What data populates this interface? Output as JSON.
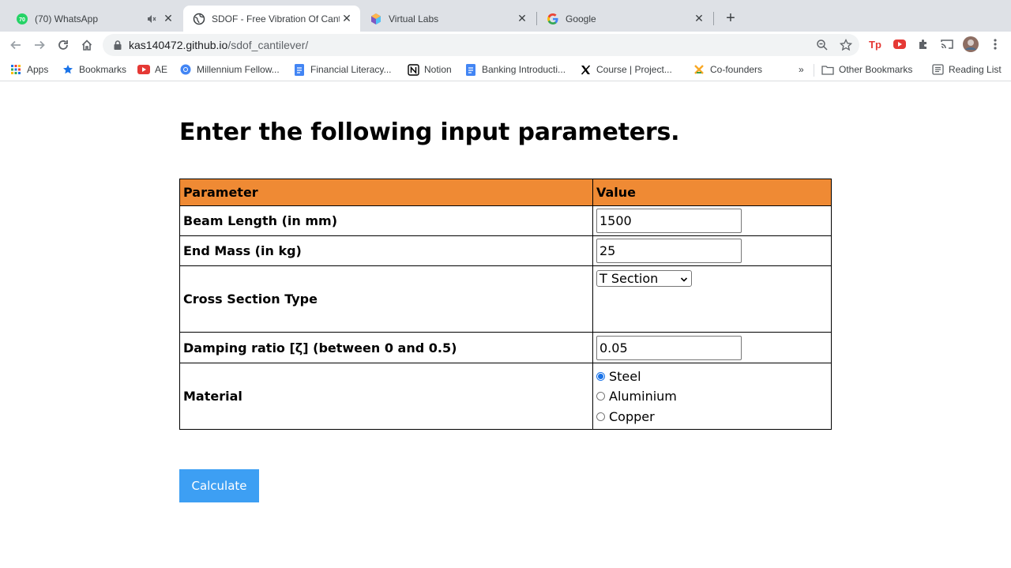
{
  "browser": {
    "tabs": [
      {
        "title": "(70) WhatsApp",
        "favicon": "whatsapp-icon",
        "badge": "70",
        "muted": true
      },
      {
        "title": "SDOF - Free Vibration Of Cantilever",
        "favicon": "globe-icon",
        "active": true
      },
      {
        "title": "Virtual Labs",
        "favicon": "virtual-labs-icon"
      },
      {
        "title": "Google",
        "favicon": "google-icon"
      }
    ],
    "url_host": "kas140472.github.io",
    "url_path": "/sdof_cantilever/",
    "bookmarks": [
      {
        "label": "Apps",
        "icon": "apps-grid-icon"
      },
      {
        "label": "Bookmarks",
        "icon": "star-icon"
      },
      {
        "label": "AE",
        "icon": "youtube-icon"
      },
      {
        "label": "Millennium Fellow...",
        "icon": "chrome-icon"
      },
      {
        "label": "Financial Literacy...",
        "icon": "google-docs-icon"
      },
      {
        "label": "Notion",
        "icon": "notion-icon"
      },
      {
        "label": "Banking Introducti...",
        "icon": "google-docs-icon"
      },
      {
        "label": "Course | Project...",
        "icon": "x-logo-icon"
      },
      {
        "label": "Co-founders",
        "icon": "cofounders-icon"
      }
    ],
    "overflow": "»",
    "other_bookmarks": "Other Bookmarks",
    "reading_list": "Reading List"
  },
  "page": {
    "heading": "Enter the following input parameters.",
    "table": {
      "col_parameter": "Parameter",
      "col_value": "Value",
      "beam_length_label": "Beam Length (in mm)",
      "beam_length_value": "1500",
      "end_mass_label": "End Mass (in kg)",
      "end_mass_value": "25",
      "cross_section_label": "Cross Section Type",
      "cross_section_value": "T Section",
      "damping_label": "Damping ratio [ζ] (between 0 and 0.5)",
      "damping_value": "0.05",
      "material_label": "Material",
      "materials": [
        "Steel",
        "Aluminium",
        "Copper"
      ],
      "material_selected": "Steel"
    },
    "calculate_label": "Calculate"
  },
  "colors": {
    "table_header": "#ef8a34",
    "button": "#3d9ff3",
    "tabstrip": "#dee1e6"
  }
}
